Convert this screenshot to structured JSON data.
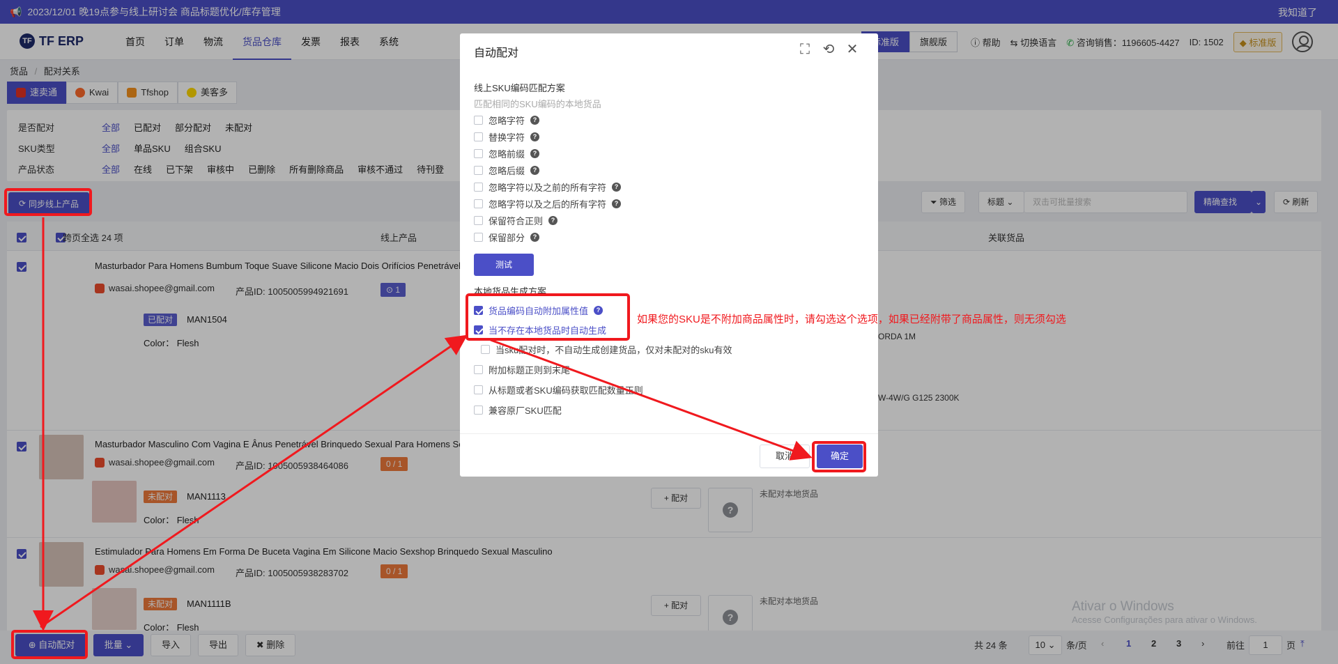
{
  "top_notice": {
    "text": "2023/12/01 晚19点参与线上研讨会 商品标题优化/库存管理",
    "ack": "我知道了"
  },
  "nav": {
    "logo": "TF ERP",
    "menu": [
      "首页",
      "订单",
      "物流",
      "货品仓库",
      "发票",
      "报表",
      "系统"
    ],
    "active_menu": "货品仓库",
    "versions": [
      "标准版",
      "旗舰版"
    ],
    "help": "帮助",
    "lang": "切换语言",
    "sales": "咨询销售：1196605-4427",
    "id": "ID: 1502",
    "badge": "标准版"
  },
  "breadcrumb": {
    "root": "货品",
    "sep": "/",
    "current": "配对关系"
  },
  "platform_tabs": [
    "速卖通",
    "Kwai",
    "Tfshop",
    "美客多"
  ],
  "filters": [
    {
      "label": "是否配对",
      "options": [
        "全部",
        "已配对",
        "部分配对",
        "未配对"
      ]
    },
    {
      "label": "SKU类型",
      "options": [
        "全部",
        "单品SKU",
        "组合SKU"
      ]
    },
    {
      "label": "产品状态",
      "options": [
        "全部",
        "在线",
        "已下架",
        "审核中",
        "已删除",
        "所有删除商品",
        "审核不通过",
        "待刊登"
      ]
    }
  ],
  "sync_button": "同步线上产品",
  "tools": {
    "filter": "筛选",
    "search_field": "标题",
    "search_placeholder": "双击可批量搜索",
    "exact": "精确查找",
    "refresh": "刷新"
  },
  "table_head": {
    "select_all": "跨页全选 24 项",
    "col_online": "线上产品",
    "col_linked": "关联货品"
  },
  "products": [
    {
      "title": "Masturbador Para Homens Bumbum Toque Suave Silicone Macio Dois Orifícios Penetrável",
      "shop": "wasai.shopee@gmail.com",
      "pid_label": "产品ID:",
      "pid": "1005005994921691",
      "count": "1",
      "tag": "已配对",
      "sku": "MAN1504",
      "color_label": "Color：",
      "color": "Flesh",
      "linked_1": "ORDA 1M",
      "linked_2": "W-4W/G G125 2300K"
    },
    {
      "title": "Masturbador Masculino Com Vagina E Ânus Penetrável Brinquedo Sexual Para Homens Se",
      "shop": "wasai.shopee@gmail.com",
      "pid_label": "产品ID:",
      "pid": "1005005938464086",
      "count": "0 / 1",
      "tag": "未配对",
      "sku": "MAN1113",
      "color_label": "Color：",
      "color": "Flesh",
      "pair": "配对",
      "unpaired": "未配对本地货品"
    },
    {
      "title": "Estimulador Para Homens Em Forma De Buceta Vagina Em Silicone Macio Sexshop Brinquedo Sexual Masculino",
      "shop": "wasai.shopee@gmail.com",
      "pid_label": "产品ID:",
      "pid": "1005005938283702",
      "count": "0 / 1",
      "tag": "未配对",
      "sku": "MAN1111B",
      "color_label": "Color：",
      "color": "Flesh",
      "pair": "配对",
      "unpaired": "未配对本地货品"
    }
  ],
  "modal": {
    "title": "自动配对",
    "section1": "线上SKU编码匹配方案",
    "section1_sub": "匹配相同的SKU编码的本地货品",
    "options1": [
      "忽略字符",
      "替换字符",
      "忽略前缀",
      "忽略后缀",
      "忽略字符以及之前的所有字符",
      "忽略字符以及之后的所有字符",
      "保留符合正则",
      "保留部分"
    ],
    "test": "测试",
    "section2": "本地货品生成方案",
    "opt_attr": "货品编码自动附加属性值",
    "opt_auto": "当不存在本地货品时自动生成",
    "opt_auto_sub": "当sku配对时，不自动生成创建货品，仅对未配对的sku有效",
    "opt_regex": "附加标题正则到末尾",
    "opt_qty": "从标题或者SKU编码获取匹配数量正则",
    "opt_oem": "兼容原厂SKU匹配",
    "cancel": "取消",
    "ok": "确定"
  },
  "annotation": "如果您的SKU是不附加商品属性时，请勾选这个选项，如果已经附带了商品属性，则无须勾选",
  "bottom": {
    "auto_pair": "自动配对",
    "batch": "批量",
    "import": "导入",
    "export": "导出",
    "delete": "删除",
    "total": "共 24 条",
    "page_size": "10",
    "per_page": "条/页",
    "pages": [
      "1",
      "2",
      "3"
    ],
    "goto": "前往",
    "goto_val": "1",
    "goto_unit": "页"
  },
  "watermark": {
    "line1": "Ativar o Windows",
    "line2": "Acesse Configurações para ativar o Windows."
  },
  "colors": {
    "primary": "#4b4fc7",
    "annotation_red": "#f0191e",
    "paired_tag": "#5b5fd0",
    "unpaired_tag": "#f07a3c"
  }
}
